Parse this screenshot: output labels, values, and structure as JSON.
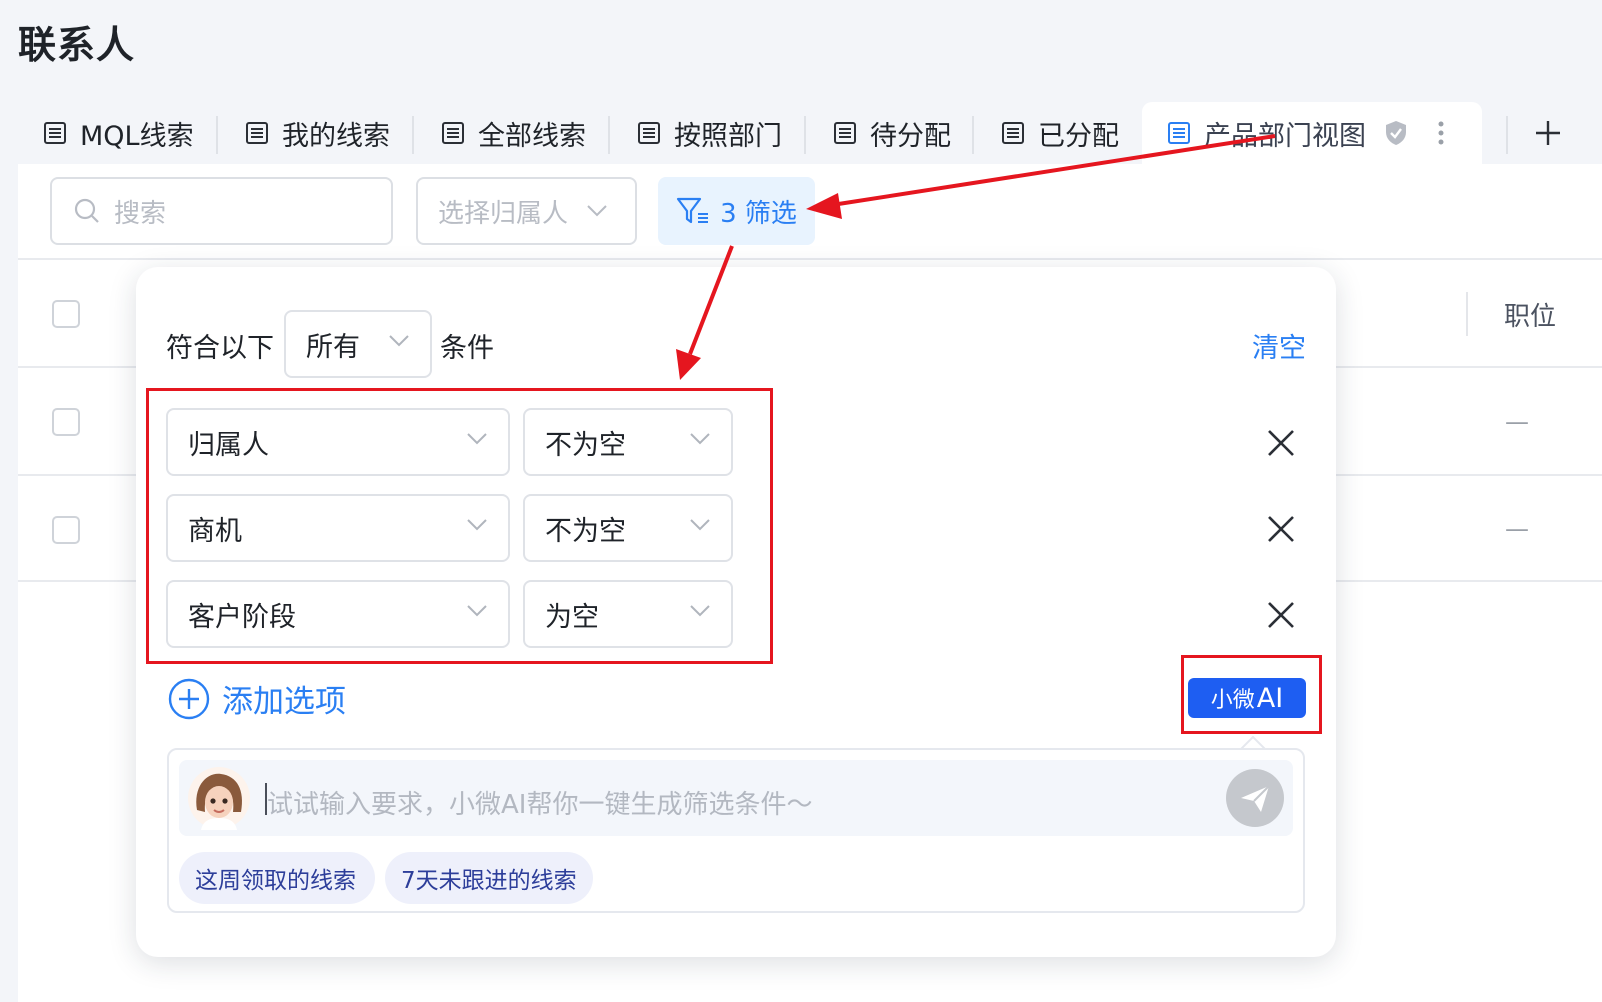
{
  "page": {
    "title": "联系人"
  },
  "tabs": [
    {
      "label": "MQL线索"
    },
    {
      "label": "我的线索"
    },
    {
      "label": "全部线索"
    },
    {
      "label": "按照部门"
    },
    {
      "label": "待分配"
    },
    {
      "label": "已分配"
    },
    {
      "label": "产品部门视图",
      "active": true
    }
  ],
  "toolbar": {
    "search_placeholder": "搜索",
    "owner_placeholder": "选择归属人",
    "filter_label": "3 筛选"
  },
  "table": {
    "visible_headers": [
      "职位"
    ],
    "rows": [
      {
        "position": "—"
      },
      {
        "position": "—"
      }
    ]
  },
  "filter_popup": {
    "prefix": "符合以下",
    "match_mode": "所有",
    "suffix": "条件",
    "clear_label": "清空",
    "conditions": [
      {
        "field": "归属人",
        "operator": "不为空"
      },
      {
        "field": "商机",
        "operator": "不为空"
      },
      {
        "field": "客户阶段",
        "operator": "为空"
      }
    ],
    "add_label": "添加选项",
    "ai_button": {
      "prefix": "小微",
      "suffix": "AI"
    },
    "ai_input_placeholder": "试试输入要求，小微AI帮你一键生成筛选条件～",
    "suggestions": [
      "这周领取的线索",
      "7天未跟进的线索"
    ]
  },
  "colors": {
    "accent": "#2a7ff3",
    "ai_button": "#1e5ef2",
    "annotation_red": "#e5161f"
  }
}
